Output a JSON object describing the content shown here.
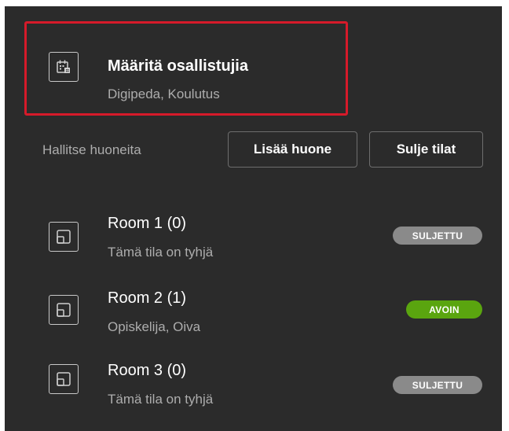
{
  "assign": {
    "title": "Määritä osallistujia",
    "subtitle": "Digipeda, Koulutus",
    "icon": "calendar-grid-icon"
  },
  "manage": {
    "label": "Hallitse huoneita",
    "add_room_label": "Lisää huone",
    "close_rooms_label": "Sulje tilat"
  },
  "rooms": [
    {
      "title": "Room 1 (0)",
      "subtitle": "Tämä tila on tyhjä",
      "status": "SULJETTU",
      "status_color": "#8a8a8a",
      "icon": "room-icon"
    },
    {
      "title": "Room 2 (1)",
      "subtitle": "Opiskelija, Oiva",
      "status": "AVOIN",
      "status_color": "#5aa50f",
      "icon": "room-icon"
    },
    {
      "title": "Room 3 (0)",
      "subtitle": "Tämä tila on tyhjä",
      "status": "SULJETTU",
      "status_color": "#8a8a8a",
      "icon": "room-icon"
    }
  ],
  "colors": {
    "panel_background": "#2b2b2b",
    "highlight_border": "#d61a2a",
    "open_badge": "#5aa50f",
    "closed_badge": "#8a8a8a"
  }
}
